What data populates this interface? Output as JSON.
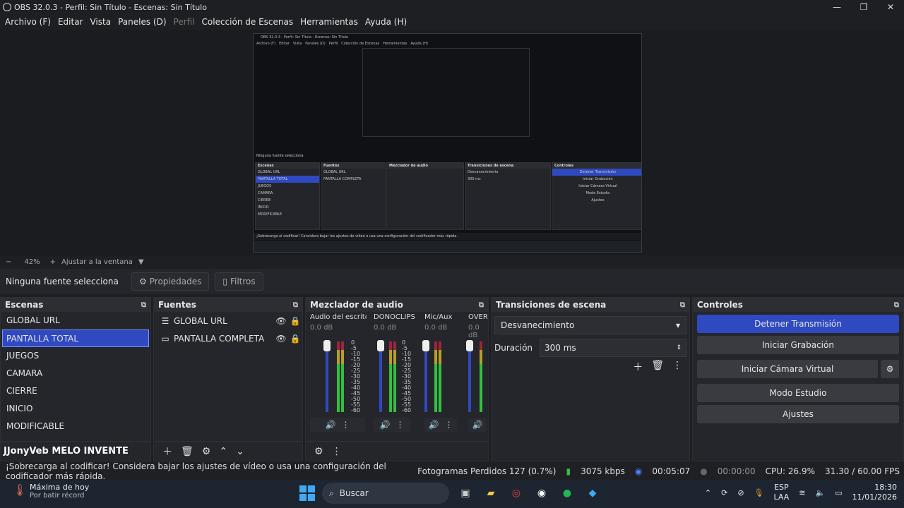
{
  "window": {
    "title": "OBS 32.0.3 - Perfil: Sin Título - Escenas: Sin Título",
    "min": "—",
    "max": "❐",
    "close": "✕"
  },
  "menu": [
    "Archivo (F)",
    "Editar",
    "Vista",
    "Paneles (D)",
    "Perfil",
    "Colección de Escenas",
    "Herramientas",
    "Ayuda (H)"
  ],
  "zoom": {
    "minus": "−",
    "value": "42%",
    "plus": "+",
    "fit": "Ajustar a la ventana",
    "arrow": "▼"
  },
  "source_toolbar": {
    "label": "Ninguna fuente selecciona",
    "properties": "Propiedades",
    "filters": "Filtros"
  },
  "scenes": {
    "title": "Escenas",
    "items": [
      "GLOBAL URL",
      "PANTALLA TOTAL",
      "JUEGOS",
      "CAMARA",
      "CIERRE",
      "INICIO",
      "MODIFICABLE"
    ],
    "selected_index": 1,
    "watermark": "JJonyVeb MELO INVENTE"
  },
  "sources": {
    "title": "Fuentes",
    "items": [
      {
        "icon": "list-icon",
        "label": "GLOBAL URL"
      },
      {
        "icon": "monitor-icon",
        "label": "PANTALLA COMPLETA"
      }
    ]
  },
  "mixer": {
    "title": "Mezclador de audio",
    "channels": [
      {
        "name": "Audio del escritorio",
        "db": "0.0 dB"
      },
      {
        "name": "DONOCLIPS",
        "db": "0.0 dB"
      },
      {
        "name": "Mic/Aux",
        "db": "0.0 dB"
      },
      {
        "name": "OVERL",
        "db": "0.0 dB"
      }
    ],
    "scale": [
      "0",
      "-5",
      "-10",
      "-15",
      "-20",
      "-25",
      "-30",
      "-35",
      "-40",
      "-45",
      "-50",
      "-55",
      "-60"
    ]
  },
  "transitions": {
    "title": "Transiciones de escena",
    "selected": "Desvanecimiento",
    "duration_label": "Duración",
    "duration_value": "300 ms"
  },
  "controls": {
    "title": "Controles",
    "buttons": [
      "Detener Transmisión",
      "Iniciar Grabación",
      "Iniciar Cámara Virtual",
      "Modo Estudio",
      "Ajustes"
    ],
    "accent": "#2f49c0"
  },
  "status": {
    "message": "¡Sobrecarga al codificar! Considera bajar los ajustes de vídeo o usa una configuración del codificador más rápida.",
    "dropped": "Fotogramas Perdidos 127 (0.7%)",
    "bitrate": "3075 kbps",
    "stream_time": "00:05:07",
    "rec_time": "00:00:00",
    "cpu": "CPU: 26.9%",
    "fps": "31.30 / 60.00 FPS"
  },
  "taskbar": {
    "weather_title": "Máxima de hoy",
    "weather_sub": "Por batir récord",
    "search": "Buscar",
    "lang1": "ESP",
    "lang2": "LAA",
    "time": "18:30",
    "date": "11/01/2026"
  }
}
